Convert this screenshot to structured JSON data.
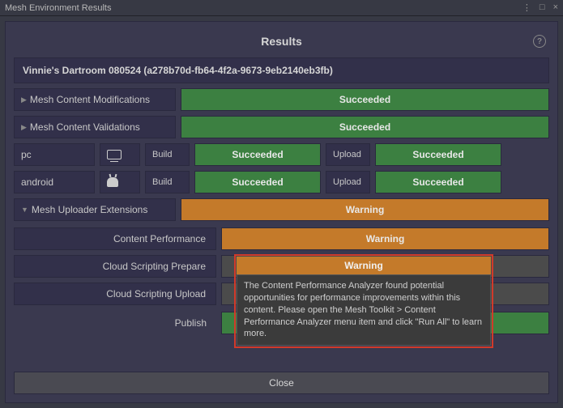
{
  "window": {
    "title": "Mesh Environment Results"
  },
  "panel": {
    "title": "Results"
  },
  "environment": {
    "name_with_id": "Vinnie's Dartroom 080524 (a278b70d-fb64-4f2a-9673-9eb2140eb3fb)"
  },
  "status": {
    "succeeded": "Succeeded",
    "warning": "Warning"
  },
  "rows": {
    "content_mods": "Mesh Content Modifications",
    "content_valid": "Mesh Content Validations",
    "uploader_ext": "Mesh Uploader Extensions",
    "content_perf": "Content Performance",
    "cloud_script_prep": "Cloud Scripting Prepare",
    "cloud_script_upload": "Cloud Scripting Upload",
    "publish": "Publish"
  },
  "platforms": {
    "pc": "pc",
    "android": "android",
    "build": "Build",
    "upload": "Upload"
  },
  "tooltip": {
    "text": "The Content Performance Analyzer found potential opportunities for performance improvements within this content. Please open the Mesh Toolkit > Content Performance Analyzer menu item and click \"Run All\" to learn more."
  },
  "buttons": {
    "close": "Close"
  }
}
